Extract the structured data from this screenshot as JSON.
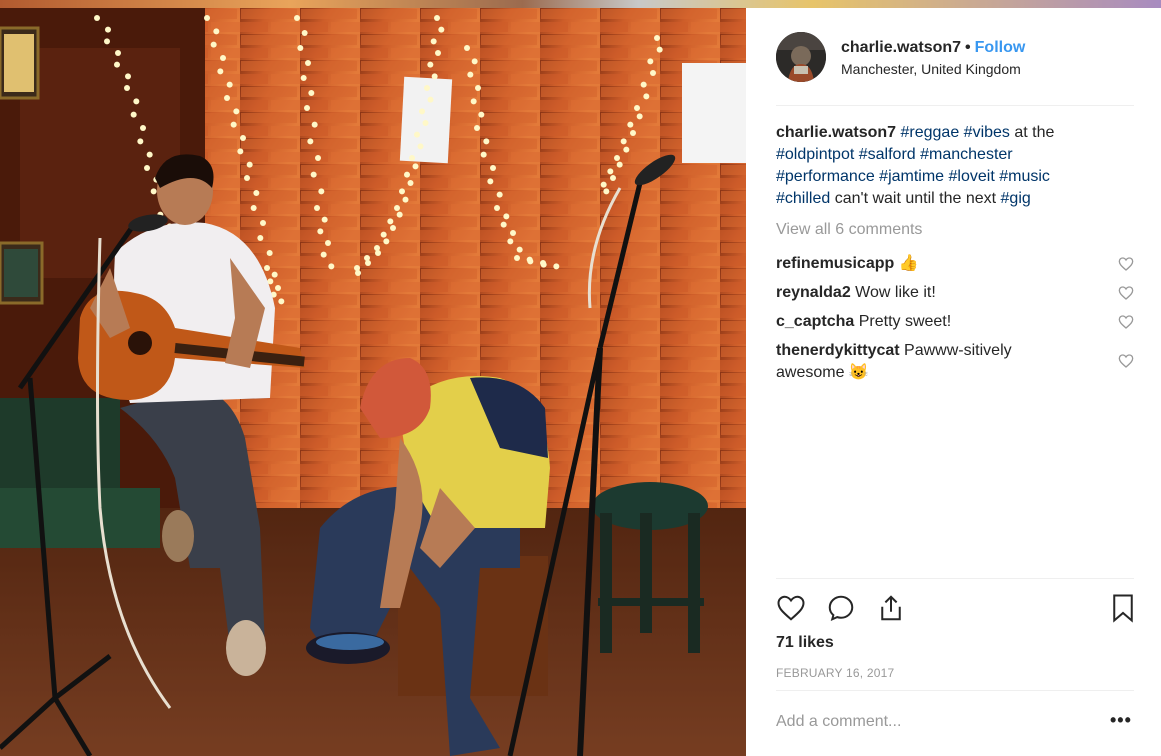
{
  "post": {
    "username": "charlie.watson7",
    "dot": "•",
    "follow_label": "Follow",
    "location": "Manchester, United Kingdom",
    "caption": {
      "username": "charlie.watson7",
      "t1": "#reggae",
      "t2": "#vibes",
      "plain1": " at the",
      "t3": "#oldpintpot",
      "t4": "#salford",
      "t5": "#manchester",
      "t6": "#performance",
      "t7": "#jamtime",
      "t8": "#loveit",
      "t9": "#music",
      "t10": "#chilled",
      "plain2": " can't wait until the next ",
      "t11": "#gig"
    },
    "view_all_comments": "View all 6 comments",
    "comments": [
      {
        "user": "refinemusicapp",
        "text": "👍"
      },
      {
        "user": "reynalda2",
        "text": "Wow like it!"
      },
      {
        "user": "c_captcha",
        "text": "Pretty sweet!"
      },
      {
        "user": "thenerdykittycat",
        "text": "Pawww-sitively awesome 😺"
      }
    ],
    "likes": "71 likes",
    "date": "FEBRUARY 16, 2017",
    "add_comment_placeholder": "Add a comment...",
    "more_label": "•••"
  },
  "icons": {
    "like": "heart-icon",
    "comment": "comment-bubble-icon",
    "share": "share-icon",
    "save": "bookmark-icon",
    "comment_like": "heart-icon"
  },
  "colors": {
    "follow": "#3897f0",
    "hashtag": "#003569",
    "muted": "#999999",
    "text": "#262626"
  }
}
